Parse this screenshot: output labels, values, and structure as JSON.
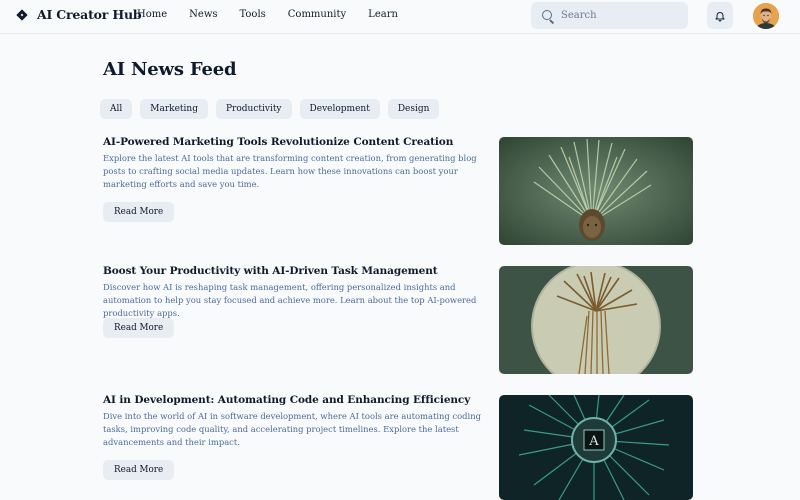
{
  "app": {
    "name": "AI Creator Hub"
  },
  "nav": {
    "items": [
      "Home",
      "News",
      "Tools",
      "Community",
      "Learn"
    ]
  },
  "search": {
    "placeholder": "Search"
  },
  "page": {
    "title": "AI News Feed"
  },
  "filters": [
    "All",
    "Marketing",
    "Productivity",
    "Development",
    "Design"
  ],
  "articles": [
    {
      "title": "AI-Powered Marketing Tools Revolutionize Content Creation",
      "summary": "Explore the latest AI tools that are transforming content creation, from generating blog posts to crafting social media updates. Learn how these innovations can boost your marketing efforts and save you time.",
      "button": "Read More"
    },
    {
      "title": "Boost Your Productivity with AI-Driven Task Management",
      "summary": "Discover how AI is reshaping task management, offering personalized insights and automation to help you stay focused and achieve more. Learn about the top AI-powered productivity apps.",
      "button": "Read More"
    },
    {
      "title": "AI in Development: Automating Code and Enhancing Efficiency",
      "summary": "Dive into the world of AI in software development, where AI tools are automating coding tasks, improving code quality, and accelerating project timelines. Explore the latest advancements and their impact.",
      "button": "Read More"
    }
  ],
  "icons": {
    "logo": "diamond-logo-icon",
    "search": "search-icon",
    "notifications": "bell-icon"
  },
  "colors": {
    "background": "#f9fafc",
    "chip": "#e8edf4",
    "summary_text": "#4a6a9a",
    "heading_text": "#0f1a2a"
  }
}
